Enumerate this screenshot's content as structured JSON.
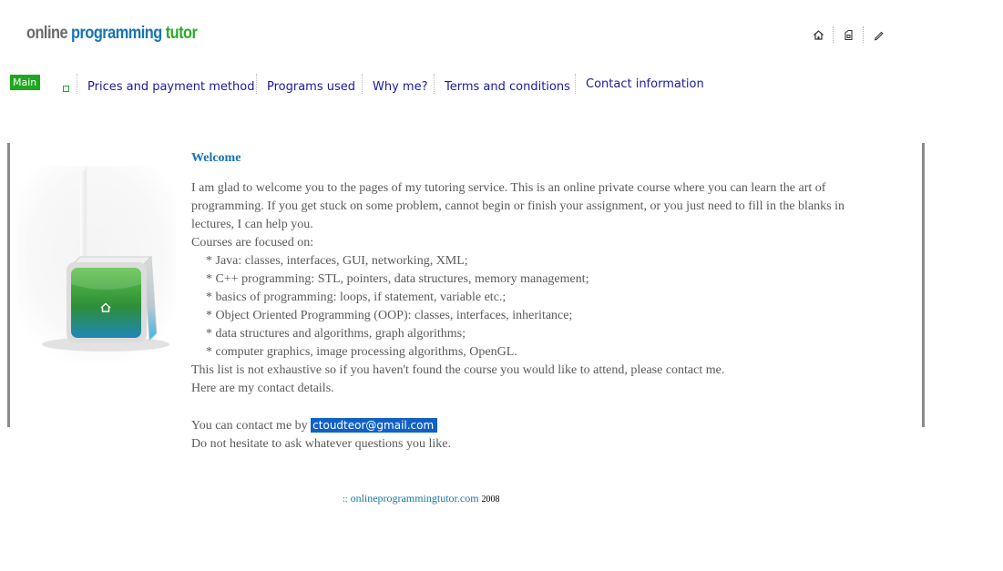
{
  "logo": {
    "word1": "online",
    "word2": "programming",
    "word3": "tutor"
  },
  "top_icons": [
    "home-icon",
    "bookmark-icon",
    "edit-icon"
  ],
  "nav": {
    "active": "Main page",
    "items": [
      "Prices and payment method",
      "Programs used",
      "Why me?",
      "Terms and conditions",
      "Contact information"
    ]
  },
  "content": {
    "title": "Welcome",
    "intro": "I am glad to welcome you to the pages of my tutoring service. This is an online private course where you can learn the art of programming. If you get stuck on some problem, cannot begin or finish your assignment, or you just need to fill in the blanks in lectures, I can help you.",
    "courses_heading": "Courses are focused on:",
    "courses": [
      "* Java: classes, interfaces, GUI, networking, XML;",
      "* C++ programming: STL, pointers, data structures, memory management;",
      "* basics of programming: loops, if statement, variable etc.;",
      "* Object Oriented Programming (OOP): classes, interfaces, inheritance;",
      "* data structures and algorithms, graph algorithms;",
      "* computer graphics, image processing algorithms, OpenGL."
    ],
    "not_exhaustive": "This list is not exhaustive so if you haven't found the course you would like to attend, please contact me.",
    "contact_details": "Here are my contact details.",
    "contact_prefix": "You can contact me by",
    "email": "ctoudteor@gmail.com",
    "closing": "Do not hesitate to ask whatever questions you like."
  },
  "footer": {
    "dots": "::",
    "site": "onlineprogrammingtutor.com",
    "year": "2008"
  },
  "colors": {
    "accent_green": "#1fa71f",
    "link_blue": "#1a1aa6",
    "title_blue": "#1672b8",
    "email_bg": "#1060c8"
  }
}
